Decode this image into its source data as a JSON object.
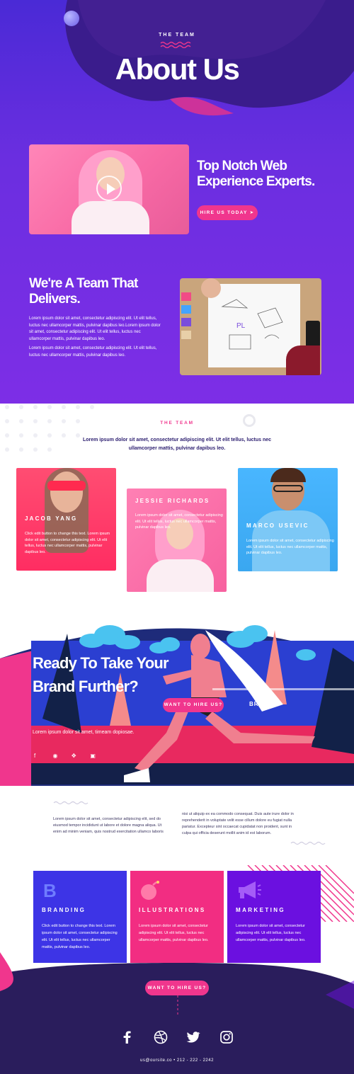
{
  "hero": {
    "eyebrow": "THE TEAM",
    "title": "About Us",
    "headline": "Top Notch Web Experience Experts.",
    "cta": "HIRE US TODAY"
  },
  "team_intro": {
    "title": "We're A Team That Delivers.",
    "paragraph_1": "Lorem ipsum dolor sit amet, consectetur adipiscing elit. Ut elit tellus, luctus nec ullamcorper mattis, pulvinar dapibus leo.Lorem ipsum dolor sit amet, consectetur adipiscing elit. Ut elit tellus, luctus nec ullamcorper mattis, pulvinar dapibus leo.",
    "paragraph_2": "Lorem ipsum dolor sit amet, consectetur adipiscing elit. Ut elit tellus, luctus nec ullamcorper mattis, pulvinar dapibus leo."
  },
  "team": {
    "eyebrow": "THE TEAM",
    "lead": "Lorem ipsum dolor sit amet, consectetur adipiscing elit. Ut elit tellus, luctus nec ullamcorper mattis, pulvinar dapibus leo.",
    "members": [
      {
        "name": "JACOB YANG",
        "desc": "Click edit button to change this text. Lorem ipsum dolor sit amet, consectetur adipiscing elit. Ut elit tellus, luctus nec ullamcorper mattis, pulvinar dapibus leo."
      },
      {
        "name": "JESSIE RICHARDS",
        "desc": "Lorem ipsum dolor sit amet, consectetur adipiscing elit. Ut elit tellus, luctus nec ullamcorper mattis, pulvinar dapibus leo."
      },
      {
        "name": "MARCO USEVIC",
        "desc": "Lorem ipsum dolor sit amet, consectetur adipiscing elit. Ut elit tellus, luctus nec ullamcorper mattis, pulvinar dapibus leo."
      }
    ]
  },
  "cta": {
    "title": "Ready To Take Your Brand Further?",
    "subtitle": "Lorem ipsum dolor sit amet, timeam dopiosae.",
    "button": "WANT TO HIRE US?",
    "partial_text": "BRE",
    "social": [
      "facebook-icon",
      "dribbble-icon",
      "twitter-icon",
      "instagram-icon"
    ]
  },
  "columns": {
    "left": "Lorem ipsum dolor sit amet, consectetur adipiscing elit, sed do eiusmod tempor incididunt ut labore et dolore magna aliqua. Ut enim ad minim veniam, quis nostrud exercitation ullamco laboris",
    "right": "nisi ut aliquip ex ea commodo consequat. Duis aute irure dolor in reprehenderit in voluptate velit esse cillum dolore eu fugiat nulla pariatur. Excepteur sint occaecat cupidatat non proident, sunt in culpa qui officia deserunt mollit anim id est laborum."
  },
  "services": [
    {
      "title": "BRANDING",
      "icon": "b-letter-icon",
      "color": "#3d34e6",
      "desc": "Click edit button to change this text. Lorem ipsum dolor sit amet, consectetur adipiscing elit. Ut elit tellus, luctus nec ullamcorper mattis, pulvinar dapibus leo."
    },
    {
      "title": "ILLUSTRATIONS",
      "icon": "bomb-icon",
      "color": "#f22d82",
      "desc": "Lorem ipsum dolor sit amet, consectetur adipiscing elit. Ut elit tellus, luctus nec ullamcorper mattis, pulvinar dapibus leo."
    },
    {
      "title": "MARKETING",
      "icon": "megaphone-icon",
      "color": "#6b10e0",
      "desc": "Lorem ipsum dolor sit amet, consectetur adipiscing elit. Ut elit tellus, luctus nec ullamcorper mattis, pulvinar dapibus leo."
    }
  ],
  "footer": {
    "button": "WANT TO HIRE US?",
    "contact": "us@oursite.co  •  212 - 222 - 2242",
    "social": [
      "facebook-icon",
      "dribbble-icon",
      "twitter-icon",
      "instagram-icon"
    ]
  },
  "colors": {
    "purple": "#5a2de0",
    "pink": "#f0368d",
    "navy": "#2a1d5c",
    "blue": "#3d34e6",
    "violet": "#6b10e0"
  }
}
